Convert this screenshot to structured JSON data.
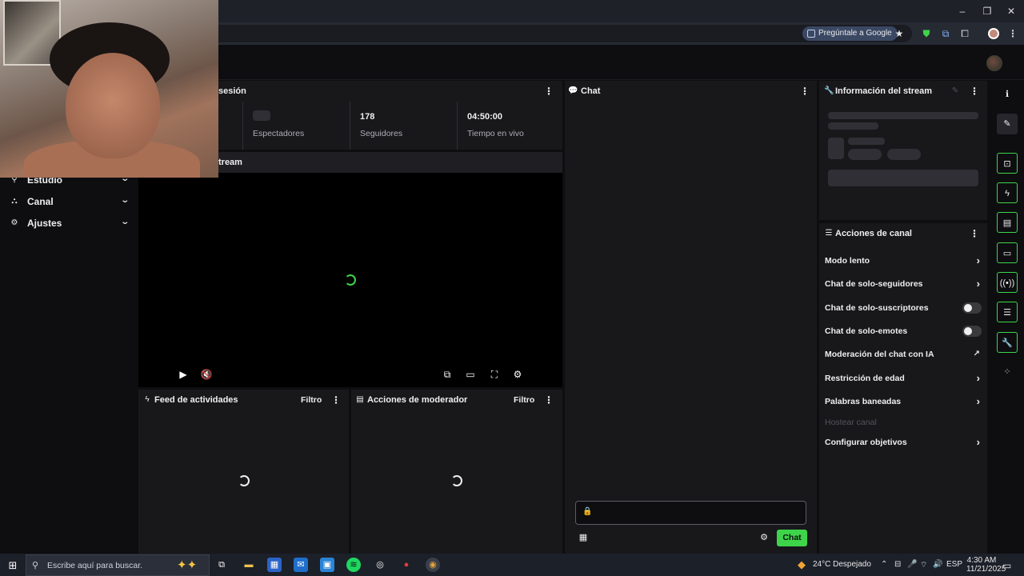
{
  "browser": {
    "ask_google_label": "Pregúntale a Google",
    "window_controls": [
      "–",
      "❐",
      "✕"
    ]
  },
  "sidebar": {
    "items": [
      {
        "label": "Estudio",
        "icon": "studio-icon"
      },
      {
        "label": "Canal",
        "icon": "channel-icon"
      },
      {
        "label": "Ajustes",
        "icon": "gear-icon"
      }
    ]
  },
  "session_panel": {
    "title_fragment": "sesión",
    "stats": [
      {
        "value": "",
        "caption": "Espectadores"
      },
      {
        "value": "178",
        "caption": "Seguidores"
      },
      {
        "value": "04:50:00",
        "caption": "Tiempo en vivo"
      }
    ]
  },
  "stream_panel": {
    "title_fragment": "tream"
  },
  "chat_panel": {
    "title": "Chat",
    "send_label": "Chat"
  },
  "activity_feed": {
    "title": "Feed de actividades",
    "filter_label": "Filtro"
  },
  "mod_actions": {
    "title": "Acciones de moderador",
    "filter_label": "Filtro"
  },
  "stream_info": {
    "title": "Información del stream"
  },
  "channel_actions": {
    "title": "Acciones de canal",
    "rows": [
      {
        "label": "Modo lento",
        "control": "chevron"
      },
      {
        "label": "Chat de solo-seguidores",
        "control": "chevron"
      },
      {
        "label": "Chat de solo-suscriptores",
        "control": "toggle",
        "on": false
      },
      {
        "label": "Chat de solo-emotes",
        "control": "toggle",
        "on": false
      },
      {
        "label": "Moderación del chat con IA",
        "control": "external"
      },
      {
        "label": "Restricción de edad",
        "control": "chevron"
      },
      {
        "label": "Palabras baneadas",
        "control": "chevron"
      },
      {
        "label": "Hostear canal",
        "control": "none",
        "disabled": true
      },
      {
        "label": "Configurar objetivos",
        "control": "chevron"
      }
    ]
  },
  "taskbar": {
    "search_placeholder": "Escribe aquí para buscar.",
    "weather": "24°C  Despejado",
    "language": "ESP",
    "time": "4:30 AM",
    "date": "11/21/2025"
  },
  "colors": {
    "accent": "#3ed44a",
    "panel": "#18181b",
    "background": "#0e0e10"
  }
}
